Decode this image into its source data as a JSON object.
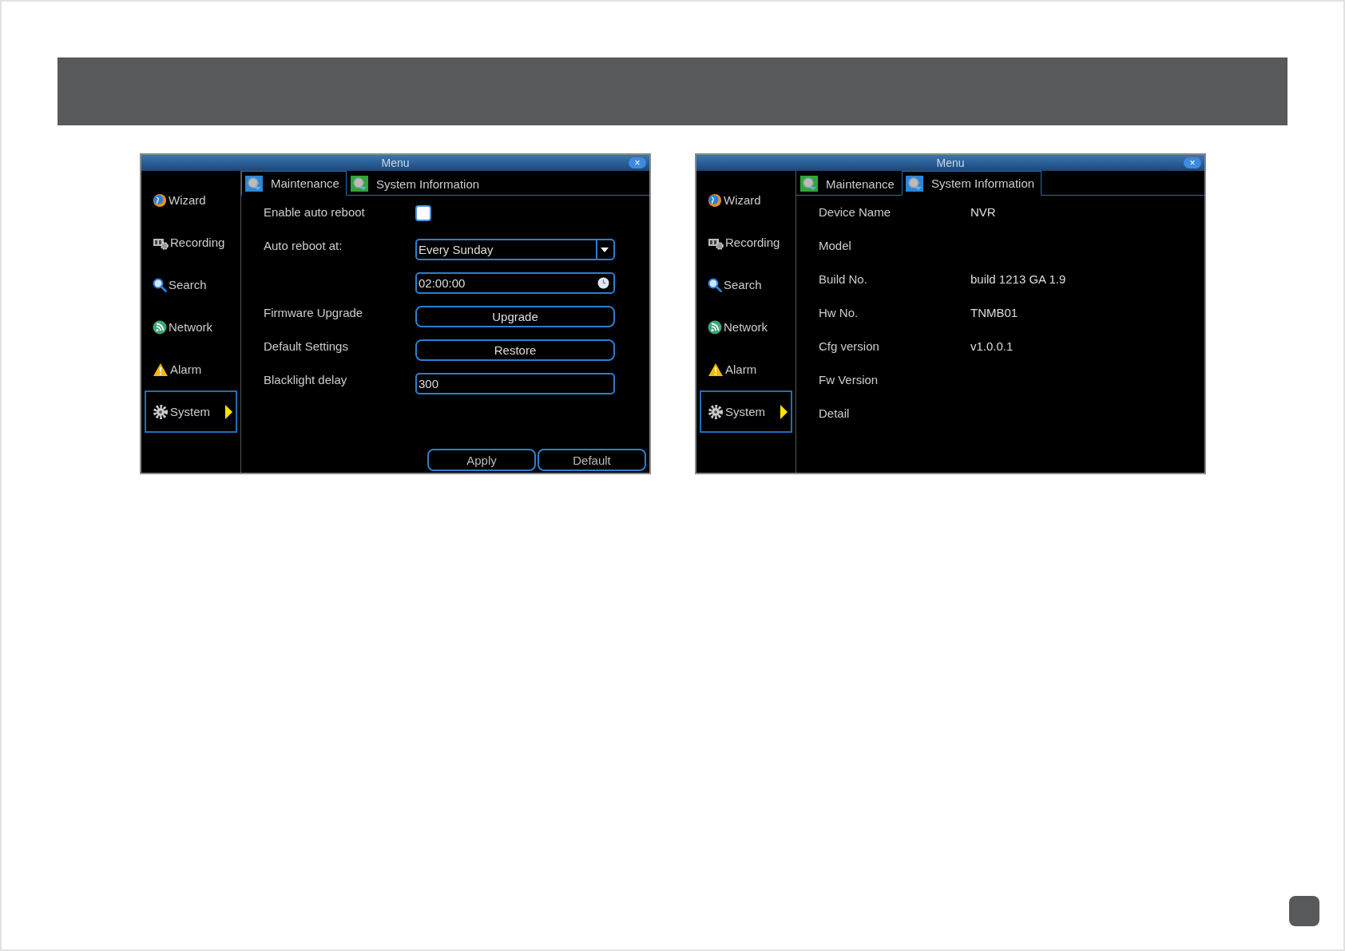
{
  "windows": [
    {
      "title": "Menu",
      "close": "×",
      "sidebar": [
        {
          "label": "Wizard",
          "selected": false
        },
        {
          "label": "Recording",
          "selected": false
        },
        {
          "label": "Search",
          "selected": false
        },
        {
          "label": "Network",
          "selected": false
        },
        {
          "label": "Alarm",
          "selected": false
        },
        {
          "label": "System",
          "selected": true
        }
      ],
      "tabs": [
        {
          "label": "Maintenance",
          "selected": true
        },
        {
          "label": "System Information",
          "selected": false
        }
      ],
      "kind": "maintenance",
      "rows": [
        {
          "kind": "checkbox",
          "label": "Enable auto reboot",
          "checked": false
        },
        {
          "kind": "select",
          "label": "Auto reboot at:",
          "value": "Every Sunday"
        },
        {
          "kind": "time",
          "value": "02:00:00"
        },
        {
          "kind": "button",
          "label": "Firmware Upgrade",
          "button": "Upgrade"
        },
        {
          "kind": "button",
          "label": "Default Settings",
          "button": "Restore"
        },
        {
          "kind": "input",
          "label": "Blacklight delay",
          "value": "300"
        }
      ],
      "buttons": [
        "Apply",
        "Default"
      ]
    },
    {
      "title": "Menu",
      "close": "×",
      "sidebar": [
        {
          "label": "Wizard",
          "selected": false
        },
        {
          "label": "Recording",
          "selected": false
        },
        {
          "label": "Search",
          "selected": false
        },
        {
          "label": "Network",
          "selected": false
        },
        {
          "label": "Alarm",
          "selected": false
        },
        {
          "label": "System",
          "selected": true
        }
      ],
      "tabs": [
        {
          "label": "Maintenance",
          "selected": false
        },
        {
          "label": "System Information",
          "selected": true
        }
      ],
      "kind": "info",
      "rows": [
        {
          "label": "Device Name",
          "value": "NVR"
        },
        {
          "label": "Model"
        },
        {
          "label": "Build No.",
          "value": "build 1213 GA 1.9"
        },
        {
          "label": "Hw No.",
          "value": "TNMB01"
        },
        {
          "label": "Cfg version",
          "value": "v1.0.0.1"
        },
        {
          "label": "Fw Version"
        },
        {
          "label": "Detail"
        }
      ]
    }
  ]
}
